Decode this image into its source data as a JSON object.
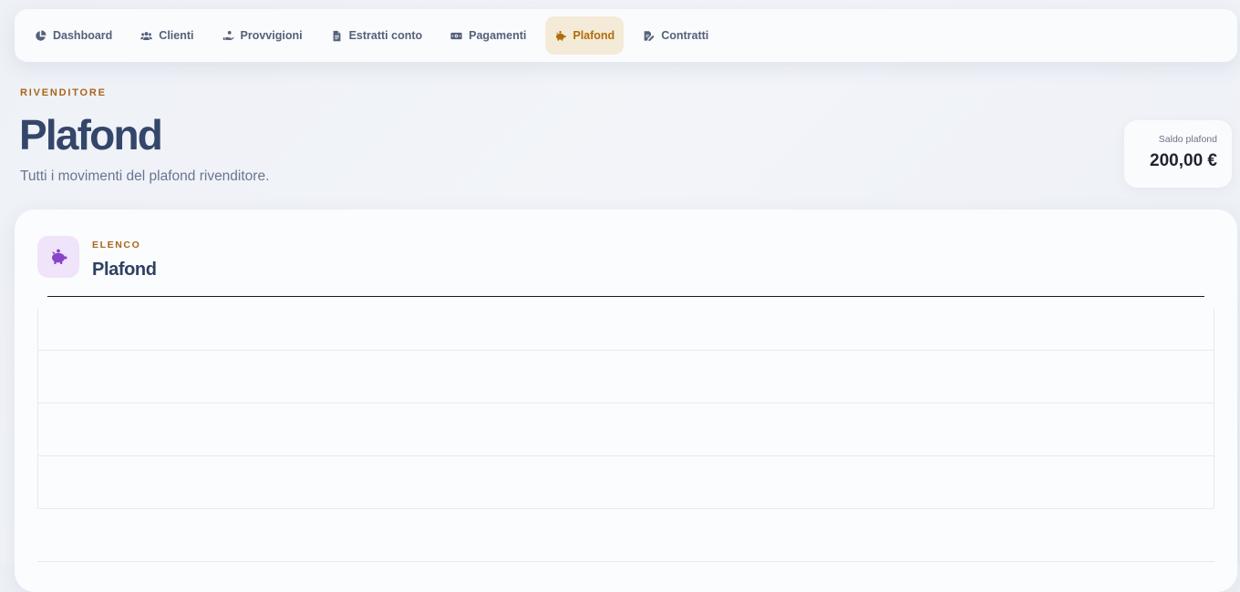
{
  "nav": {
    "items": [
      {
        "label": "Dashboard",
        "icon": "chart-pie-icon",
        "active": false
      },
      {
        "label": "Clienti",
        "icon": "users-icon",
        "active": false
      },
      {
        "label": "Provvigioni",
        "icon": "hand-coin-icon",
        "active": false
      },
      {
        "label": "Estratti conto",
        "icon": "document-icon",
        "active": false
      },
      {
        "label": "Pagamenti",
        "icon": "money-bill-icon",
        "active": false
      },
      {
        "label": "Plafond",
        "icon": "piggy-bank-icon",
        "active": true
      },
      {
        "label": "Contratti",
        "icon": "contract-signature-icon",
        "active": false
      }
    ]
  },
  "header": {
    "eyebrow": "RIVENDITORE",
    "title": "Plafond",
    "subtitle": "Tutti i movimenti del plafond rivenditore."
  },
  "balance": {
    "label": "Saldo plafond",
    "value": "200,00 €"
  },
  "card": {
    "icon": "piggy-bank-icon",
    "eyebrow": "ELENCO",
    "title": "Plafond"
  },
  "colors": {
    "accent": "#b06d0c",
    "active_nav_bg": "#f4ead8",
    "heading": "#34466a",
    "icon_purple": "#8a44c8",
    "icon_bg": "#efe4f9"
  }
}
